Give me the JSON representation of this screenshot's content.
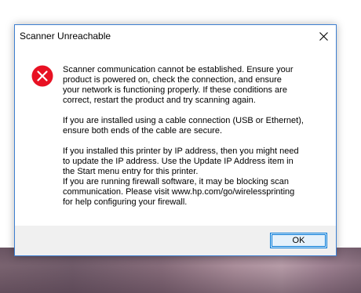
{
  "window": {
    "title": "Scanner Unreachable",
    "close_icon": "close-icon"
  },
  "message": {
    "icon": "error-icon",
    "paragraph_1": "Scanner communication cannot be established.  Ensure your\nproduct is powered on, check the connection, and ensure\nyour network is functioning properly.  If these conditions are\ncorrect, restart the product and try scanning again.",
    "paragraph_2": "If you are installed using a cable connection (USB or Ethernet),\nensure both ends of the cable are secure.",
    "paragraph_3": "If you installed this printer by IP address, then you might need\nto update the IP address.  Use the Update IP Address item in\nthe Start menu entry for this printer.",
    "paragraph_4": "If you are running firewall software, it may be blocking scan\ncommunication.  Please visit www.hp.com/go/wirelessprinting\nfor help configuring your firewall."
  },
  "buttons": {
    "ok_label": "OK"
  },
  "colors": {
    "error_red": "#e81123",
    "accent_blue": "#0078d7",
    "footer_gray": "#f0f0f0"
  }
}
